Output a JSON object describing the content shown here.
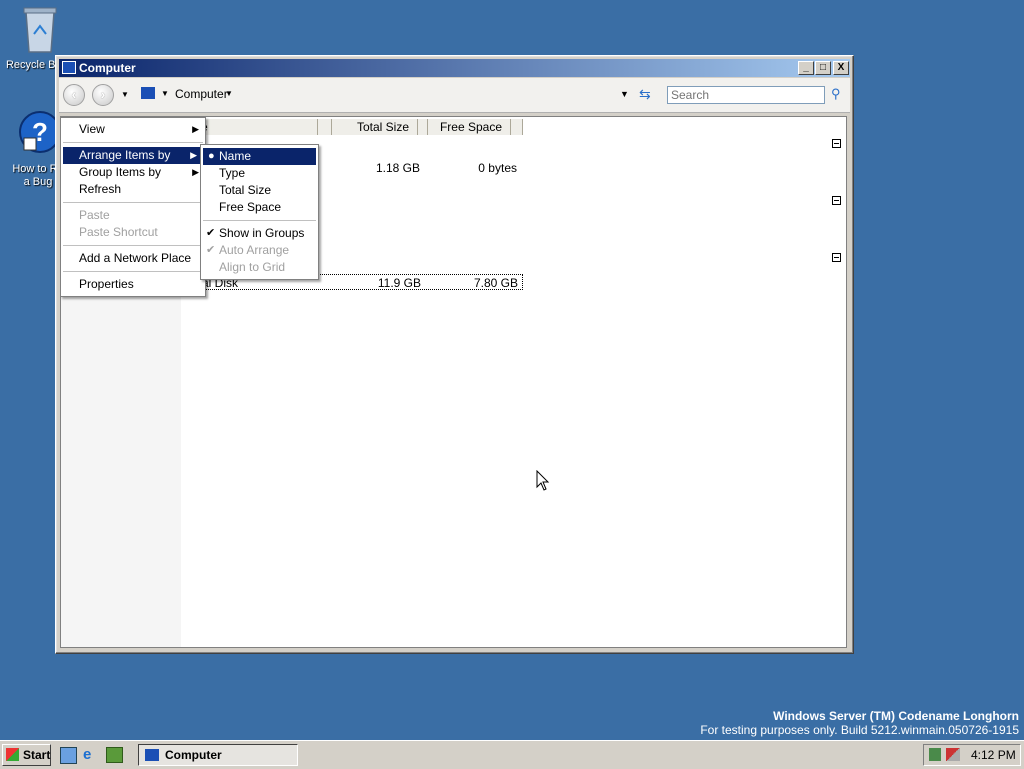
{
  "desktop": {
    "recycle_label": "Recycle Bin",
    "howto_label_1": "How to Re",
    "howto_label_2": "a Bug",
    "watermark_title": "Windows Server (TM) Codename Longhorn",
    "watermark_build": "For testing purposes only. Build 5212.winmain.050726-1915"
  },
  "window": {
    "title": "Computer",
    "minimize": "_",
    "maximize": "□",
    "close": "X",
    "breadcrumb": "Computer",
    "search_placeholder": "Search"
  },
  "columns": {
    "name": "e",
    "total_size": "Total Size",
    "free_space": "Free Space"
  },
  "rows": [
    {
      "name": "",
      "total": "1.18 GB",
      "free": "0 bytes"
    },
    {
      "name": "al Disk",
      "total": "11.9 GB",
      "free": "7.80 GB"
    }
  ],
  "context_menu": {
    "view": "View",
    "arrange": "Arrange Items by",
    "group": "Group Items by",
    "refresh": "Refresh",
    "paste": "Paste",
    "paste_shortcut": "Paste Shortcut",
    "add_network": "Add a Network Place",
    "properties": "Properties"
  },
  "submenu": {
    "name": "Name",
    "type": "Type",
    "total_size": "Total Size",
    "free_space": "Free Space",
    "show_groups": "Show in Groups",
    "auto_arrange": "Auto Arrange",
    "align_grid": "Align to Grid"
  },
  "taskbar": {
    "start": "Start",
    "task_computer": "Computer",
    "clock": "4:12 PM"
  },
  "colors": {
    "desktop": "#3a6ea5",
    "selection": "#0a246a"
  }
}
